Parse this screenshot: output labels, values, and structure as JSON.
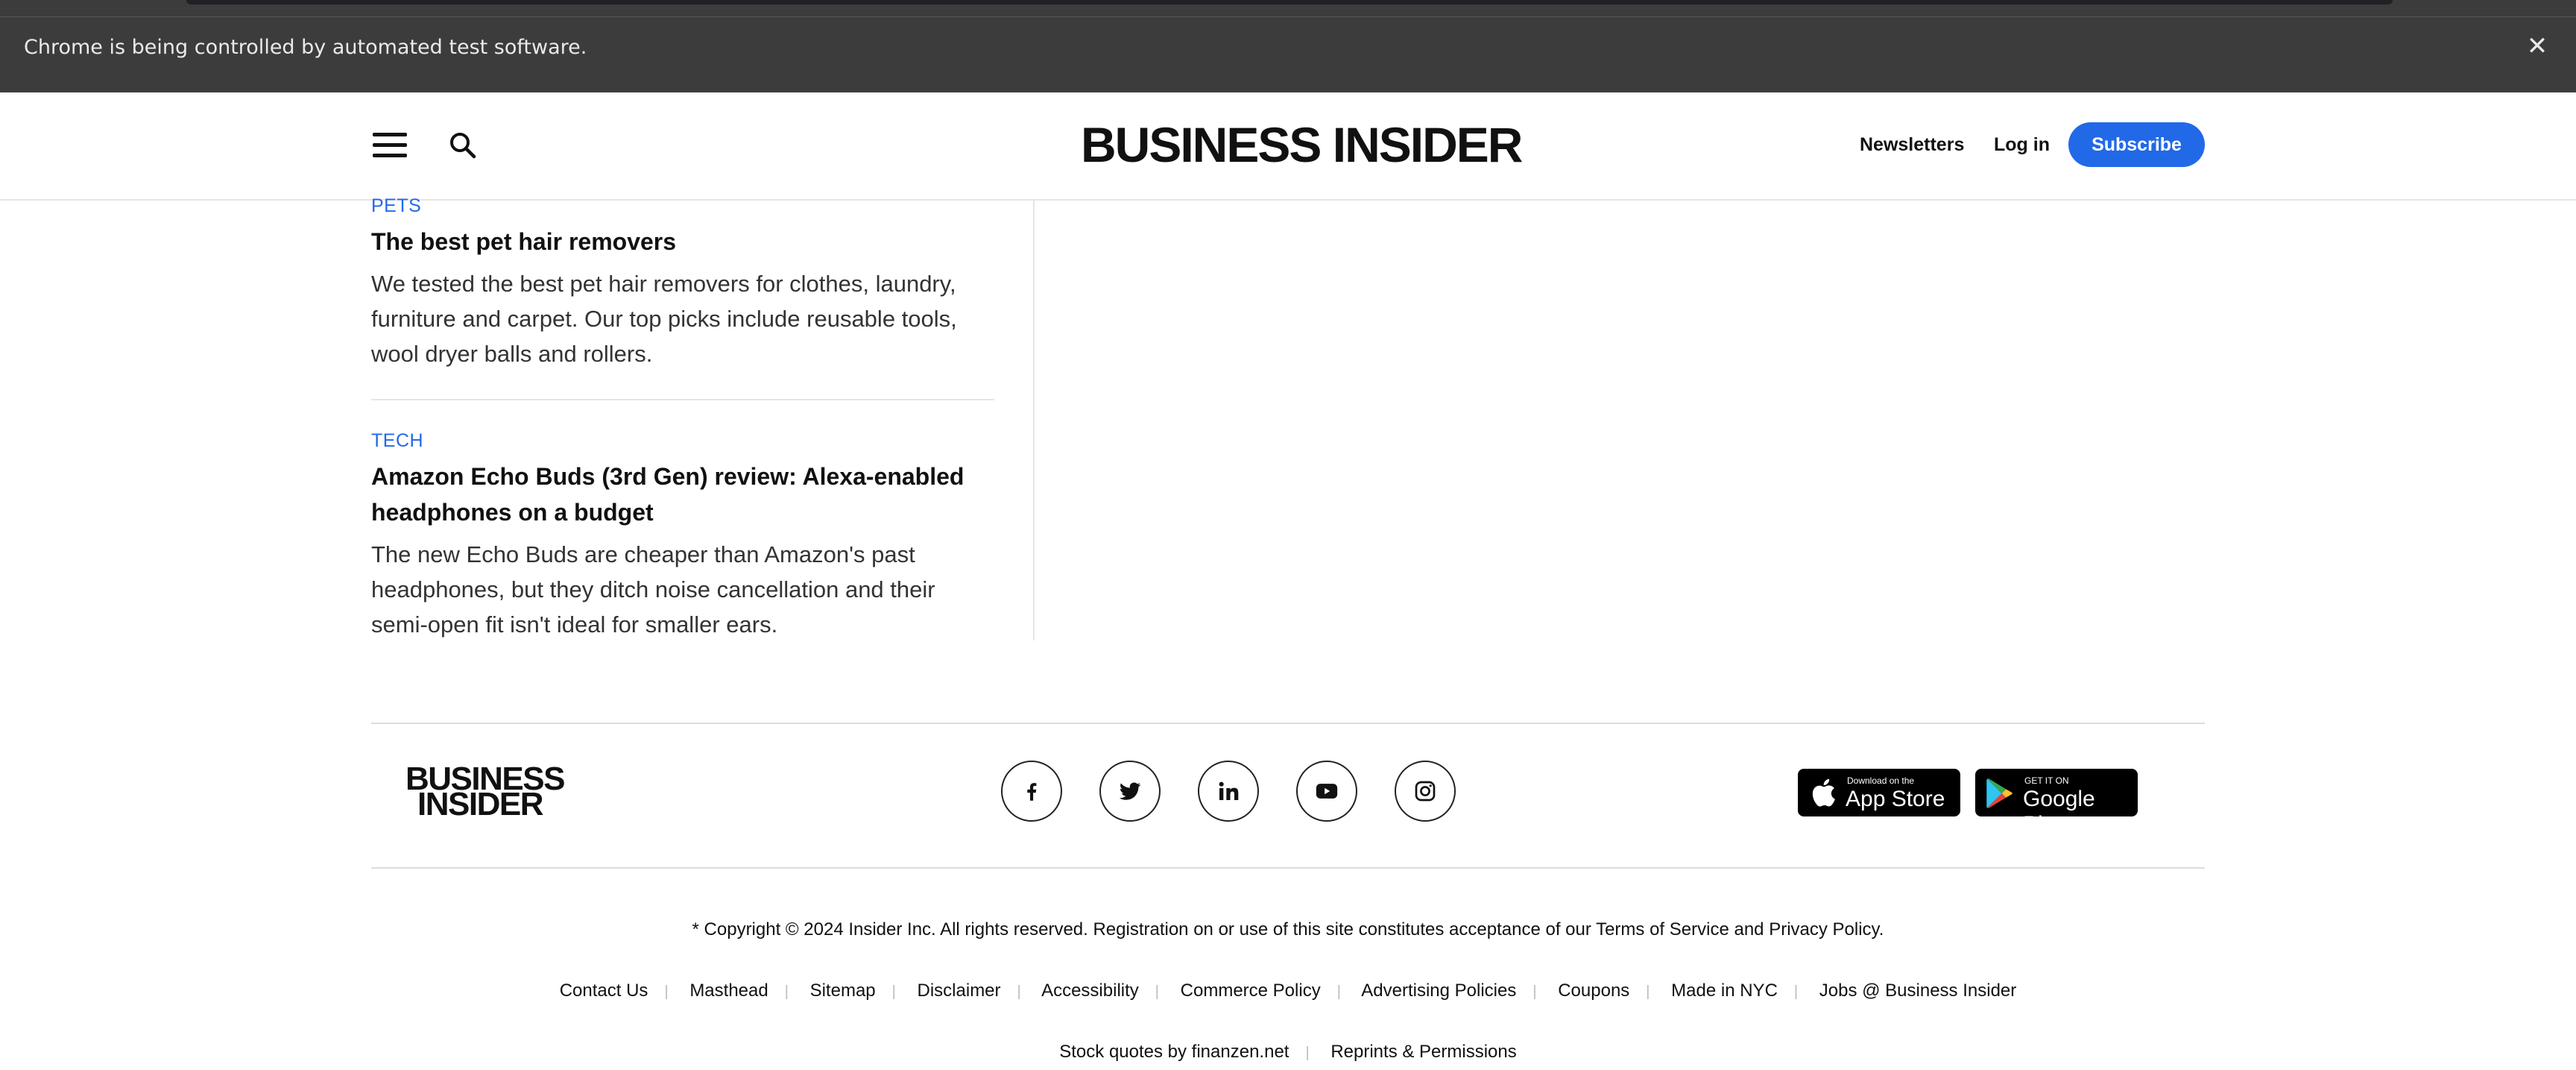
{
  "browser": {
    "automation_banner": "Chrome is being controlled by automated test software.",
    "close_symbol": "✕"
  },
  "header": {
    "logo": "BUSINESS INSIDER",
    "newsletters": "Newsletters",
    "login": "Log in",
    "subscribe": "Subscribe"
  },
  "articles": [
    {
      "category": "PETS",
      "title": "The best pet hair removers",
      "summary_lines": [
        "We tested the best pet hair removers for clothes, laundry,",
        "furniture and carpet. Our top picks include reusable tools,",
        "wool dryer balls and rollers."
      ]
    },
    {
      "category": "TECH",
      "title_lines": [
        "Amazon Echo Buds (3rd Gen) review: Alexa-enabled",
        "headphones on a budget"
      ],
      "summary_lines": [
        "The new Echo Buds are cheaper than Amazon's past",
        "headphones, but they ditch noise cancellation and their",
        "semi-open fit isn't ideal for smaller ears."
      ]
    }
  ],
  "footer": {
    "logo_line1": "BUSINESS",
    "logo_line2": "INSIDER",
    "social": [
      "facebook-icon",
      "twitter-icon",
      "linkedin-icon",
      "youtube-icon",
      "instagram-icon"
    ],
    "app_store": {
      "small": "Download on the",
      "big": "App Store"
    },
    "google_play": {
      "small": "GET IT ON",
      "big": "Google Play"
    },
    "copyright_prefix": "* Copyright © 2024 Insider Inc. All rights reserved. Registration on or use of this site constitutes acceptance of our",
    "terms": "Terms of Service",
    "and": "and",
    "privacy": "Privacy Policy",
    "period": ".",
    "links": [
      "Contact Us",
      "Masthead",
      "Sitemap",
      "Disclaimer",
      "Accessibility",
      "Commerce Policy",
      "Advertising Policies",
      "Coupons",
      "Made in NYC",
      "Jobs @ Business Insider"
    ],
    "links2": [
      "Stock quotes by finanzen.net",
      "Reprints & Permissions"
    ]
  },
  "colors": {
    "accent": "#2269e8",
    "banner": "#3c3c3c",
    "text": "#111111"
  }
}
